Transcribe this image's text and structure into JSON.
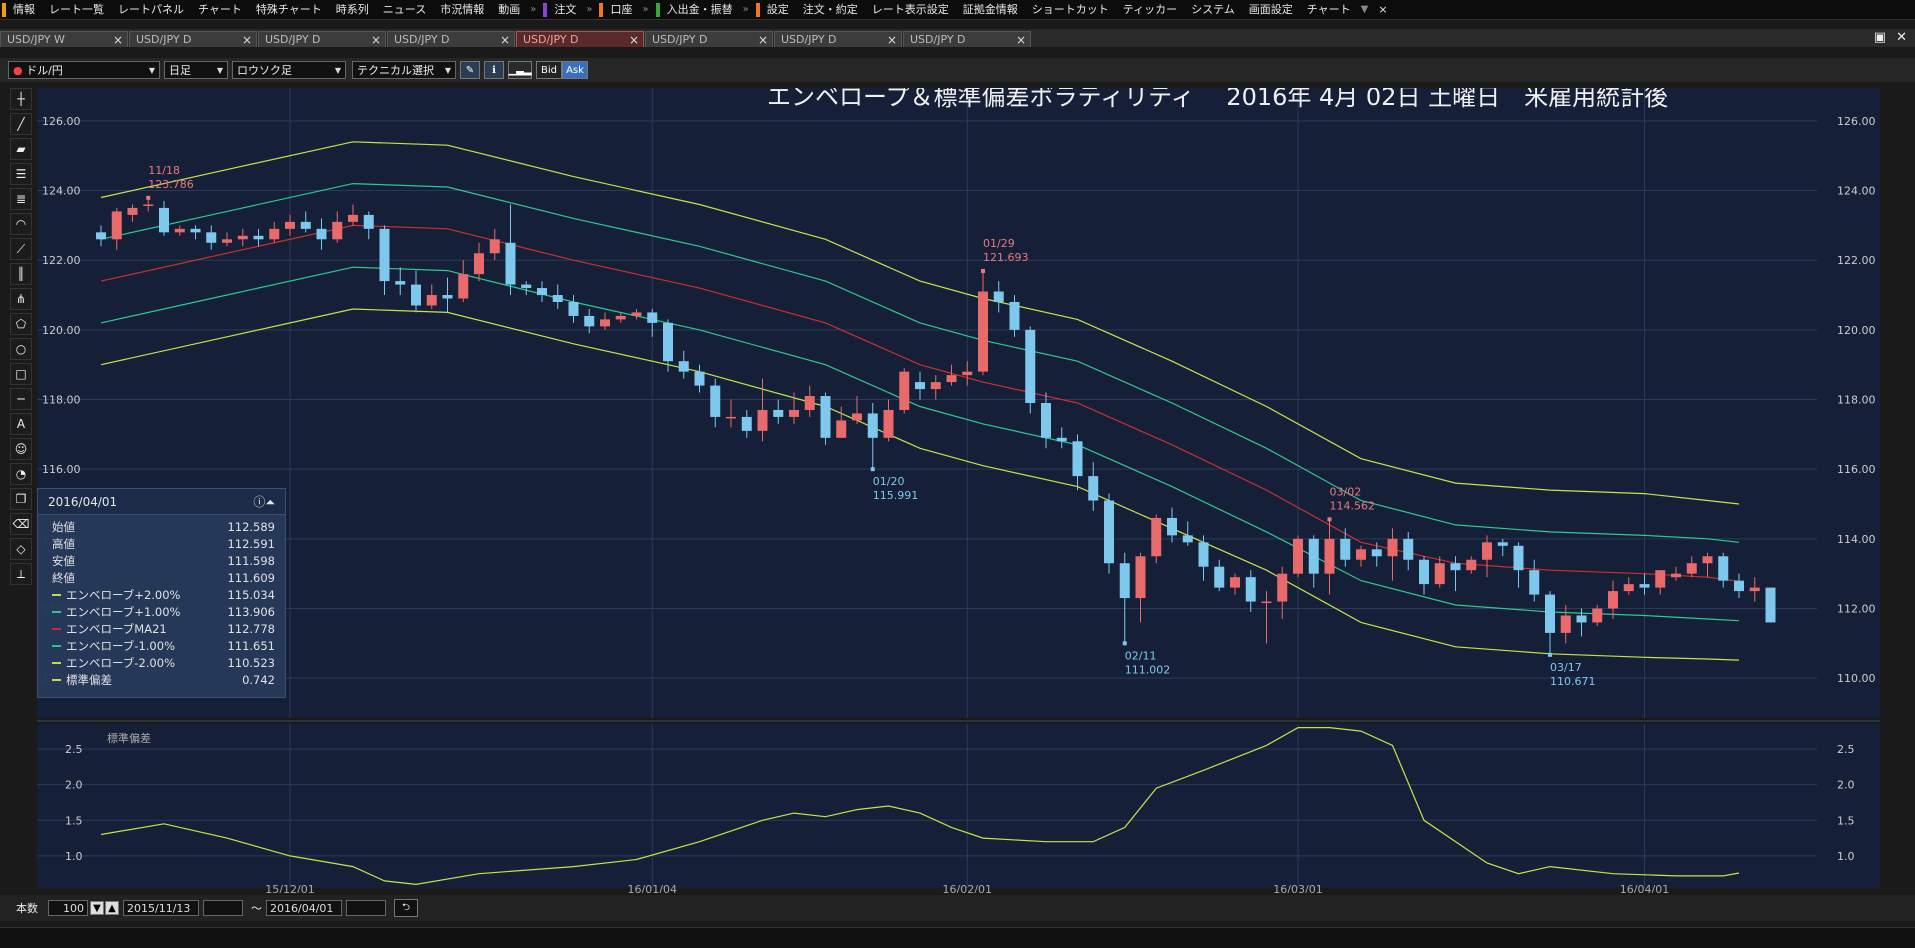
{
  "menubar": {
    "items": [
      "情報",
      "レート一覧",
      "レートパネル",
      "チャート",
      "特殊チャート",
      "時系列",
      "ニュース",
      "市況情報",
      "動画",
      "注文",
      "口座",
      "入出金・振替",
      "設定",
      "注文・約定",
      "レート表示設定",
      "証拠金情報",
      "ショートカット",
      "ティッカー",
      "システム",
      "画面設定",
      "チャート"
    ],
    "close": "×"
  },
  "tabs": [
    {
      "label": "USD/JPY W",
      "active": false
    },
    {
      "label": "USD/JPY D",
      "active": false
    },
    {
      "label": "USD/JPY D",
      "active": false
    },
    {
      "label": "USD/JPY D",
      "active": false
    },
    {
      "label": "USD/JPY D",
      "active": true
    },
    {
      "label": "USD/JPY D",
      "active": false
    },
    {
      "label": "USD/JPY D",
      "active": false
    },
    {
      "label": "USD/JPY D",
      "active": false
    }
  ],
  "toolbar": {
    "pair": "ドル/円",
    "period": "日足",
    "style": "ロウソク足",
    "technical": "テクニカル選択",
    "bid": "Bid",
    "ask": "Ask"
  },
  "tools": [
    "cross-icon",
    "line-icon",
    "eraser-icon",
    "hlines-icon",
    "multi-lines-icon",
    "arc-icon",
    "fan-icon",
    "vlines-icon",
    "pitchfork-icon",
    "pentagon-icon",
    "circle-icon",
    "rect-icon",
    "hline-icon",
    "text-icon",
    "smiley-icon",
    "paint-icon",
    "copy-icon",
    "delete-icon",
    "tag-icon",
    "ruler-icon"
  ],
  "bottombar": {
    "count_label": "本数",
    "count_value": "100",
    "from_date": "2015/11/13",
    "tilde": "〜",
    "to_date": "2016/04/01"
  },
  "info_panel": {
    "date": "2016/04/01",
    "rows": [
      {
        "label": "始値",
        "value": "112.589",
        "color": ""
      },
      {
        "label": "高値",
        "value": "112.591",
        "color": ""
      },
      {
        "label": "安値",
        "value": "111.598",
        "color": ""
      },
      {
        "label": "終値",
        "value": "111.609",
        "color": ""
      },
      {
        "label": "エンベローブ+2.00%",
        "value": "115.034",
        "color": "#c8e24a"
      },
      {
        "label": "エンベローブ+1.00%",
        "value": "113.906",
        "color": "#2ec990"
      },
      {
        "label": "エンベローブMA21",
        "value": "112.778",
        "color": "#c83030"
      },
      {
        "label": "エンベローブ-1.00%",
        "value": "111.651",
        "color": "#2ec990"
      },
      {
        "label": "エンベローブ-2.00%",
        "value": "110.523",
        "color": "#c8e24a"
      },
      {
        "label": "標準偏差",
        "value": "0.742",
        "color": "#c8e24a"
      }
    ]
  },
  "chart_data": {
    "type": "candlestick",
    "title": "エンベロープ＆標準偏差ボラティリティ　 2016年 4月 02日 土曜日　米雇用統計後",
    "ylim": [
      109.0,
      126.8
    ],
    "yticks": [
      "126.00",
      "124.00",
      "122.00",
      "120.00",
      "118.00",
      "116.00",
      "114.00",
      "112.00",
      "110.00"
    ],
    "xticks": [
      "15/12/01",
      "16/01/04",
      "16/02/01",
      "16/03/01",
      "16/04/01"
    ],
    "xtick_index": [
      12,
      35,
      55,
      76,
      98
    ],
    "candles": [
      [
        122.8,
        122.6,
        123.0,
        122.4
      ],
      [
        122.6,
        123.4,
        123.5,
        122.3
      ],
      [
        123.3,
        123.5,
        123.6,
        123.1
      ],
      [
        123.6,
        123.6,
        123.79,
        123.4
      ],
      [
        123.5,
        122.8,
        123.7,
        122.7
      ],
      [
        122.8,
        122.9,
        123.0,
        122.7
      ],
      [
        122.9,
        122.8,
        123.0,
        122.6
      ],
      [
        122.8,
        122.5,
        123.0,
        122.3
      ],
      [
        122.5,
        122.6,
        122.8,
        122.4
      ],
      [
        122.6,
        122.7,
        122.9,
        122.4
      ],
      [
        122.7,
        122.6,
        122.9,
        122.4
      ],
      [
        122.6,
        122.9,
        123.1,
        122.5
      ],
      [
        122.9,
        123.1,
        123.3,
        122.7
      ],
      [
        123.1,
        122.9,
        123.4,
        122.8
      ],
      [
        122.9,
        122.6,
        123.2,
        122.3
      ],
      [
        122.6,
        123.1,
        123.4,
        122.5
      ],
      [
        123.1,
        123.3,
        123.6,
        123.0
      ],
      [
        123.3,
        122.9,
        123.4,
        122.6
      ],
      [
        122.9,
        121.4,
        123.0,
        121.0
      ],
      [
        121.4,
        121.3,
        121.8,
        121.0
      ],
      [
        121.3,
        120.7,
        121.7,
        120.5
      ],
      [
        120.7,
        121.0,
        121.3,
        120.6
      ],
      [
        121.0,
        120.9,
        121.5,
        120.5
      ],
      [
        120.9,
        121.6,
        122.0,
        120.8
      ],
      [
        121.6,
        122.2,
        122.5,
        121.4
      ],
      [
        122.2,
        122.6,
        122.9,
        122.0
      ],
      [
        122.5,
        121.3,
        123.6,
        121.0
      ],
      [
        121.3,
        121.2,
        121.4,
        121.0
      ],
      [
        121.2,
        121.0,
        121.4,
        120.8
      ],
      [
        121.0,
        120.8,
        121.3,
        120.6
      ],
      [
        120.8,
        120.4,
        121.0,
        120.2
      ],
      [
        120.4,
        120.1,
        120.6,
        119.9
      ],
      [
        120.1,
        120.3,
        120.5,
        120.0
      ],
      [
        120.3,
        120.4,
        120.5,
        120.2
      ],
      [
        120.4,
        120.5,
        120.6,
        120.3
      ],
      [
        120.5,
        120.2,
        120.6,
        119.8
      ],
      [
        120.2,
        119.1,
        120.3,
        118.8
      ],
      [
        119.1,
        118.8,
        119.4,
        118.6
      ],
      [
        118.8,
        118.4,
        119.0,
        118.2
      ],
      [
        118.4,
        117.5,
        118.6,
        117.2
      ],
      [
        117.5,
        117.5,
        118.0,
        117.2
      ],
      [
        117.5,
        117.1,
        117.7,
        116.9
      ],
      [
        117.1,
        117.7,
        118.6,
        116.8
      ],
      [
        117.7,
        117.5,
        118.0,
        117.3
      ],
      [
        117.5,
        117.7,
        118.2,
        117.3
      ],
      [
        117.7,
        118.1,
        118.4,
        117.5
      ],
      [
        118.1,
        116.9,
        118.2,
        116.7
      ],
      [
        116.9,
        117.4,
        117.8,
        116.9
      ],
      [
        117.4,
        117.6,
        118.1,
        117.3
      ],
      [
        117.6,
        116.9,
        117.9,
        116.0
      ],
      [
        116.9,
        117.7,
        118.0,
        116.8
      ],
      [
        117.7,
        118.8,
        118.9,
        117.6
      ],
      [
        118.5,
        118.3,
        118.8,
        118.0
      ],
      [
        118.3,
        118.5,
        118.7,
        118.0
      ],
      [
        118.5,
        118.7,
        119.0,
        118.4
      ],
      [
        118.7,
        118.8,
        119.1,
        118.4
      ],
      [
        118.8,
        121.1,
        121.69,
        118.7
      ],
      [
        121.1,
        120.8,
        121.4,
        120.5
      ],
      [
        120.8,
        120.0,
        121.0,
        119.8
      ],
      [
        120.0,
        117.9,
        120.1,
        117.6
      ],
      [
        117.9,
        116.9,
        118.2,
        116.6
      ],
      [
        116.9,
        116.8,
        117.2,
        116.6
      ],
      [
        116.8,
        115.8,
        117.0,
        115.4
      ],
      [
        115.8,
        115.1,
        116.2,
        114.8
      ],
      [
        115.1,
        113.3,
        115.3,
        113.0
      ],
      [
        113.3,
        112.3,
        113.6,
        111.0
      ],
      [
        112.3,
        113.5,
        113.6,
        111.6
      ],
      [
        113.5,
        114.6,
        114.7,
        113.3
      ],
      [
        114.6,
        114.1,
        114.9,
        113.9
      ],
      [
        114.1,
        113.9,
        114.5,
        113.8
      ],
      [
        113.9,
        113.2,
        114.1,
        112.8
      ],
      [
        113.2,
        112.6,
        113.4,
        112.5
      ],
      [
        112.6,
        112.9,
        113.0,
        112.4
      ],
      [
        112.9,
        112.2,
        113.1,
        111.9
      ],
      [
        112.2,
        112.2,
        112.5,
        111.0
      ],
      [
        112.2,
        113.0,
        113.2,
        111.7
      ],
      [
        113.0,
        114.0,
        114.1,
        112.9
      ],
      [
        114.0,
        113.0,
        114.1,
        112.6
      ],
      [
        113.0,
        114.0,
        114.56,
        112.4
      ],
      [
        114.0,
        113.4,
        114.3,
        113.2
      ],
      [
        113.4,
        113.7,
        113.8,
        113.2
      ],
      [
        113.7,
        113.5,
        113.9,
        113.2
      ],
      [
        113.5,
        114.0,
        114.3,
        112.8
      ],
      [
        114.0,
        113.4,
        114.2,
        113.1
      ],
      [
        113.4,
        112.7,
        113.5,
        112.4
      ],
      [
        112.7,
        113.3,
        113.5,
        112.6
      ],
      [
        113.3,
        113.1,
        113.5,
        112.5
      ],
      [
        113.1,
        113.4,
        113.5,
        113.0
      ],
      [
        113.4,
        113.9,
        114.1,
        112.9
      ],
      [
        113.9,
        113.8,
        114.0,
        113.5
      ],
      [
        113.8,
        113.1,
        113.9,
        112.6
      ],
      [
        113.1,
        112.4,
        113.4,
        112.2
      ],
      [
        112.4,
        111.3,
        112.5,
        110.67
      ],
      [
        111.3,
        111.8,
        112.1,
        111.0
      ],
      [
        111.8,
        111.6,
        112.0,
        111.2
      ],
      [
        111.6,
        112.0,
        112.1,
        111.5
      ],
      [
        112.0,
        112.5,
        112.8,
        111.7
      ],
      [
        112.5,
        112.7,
        112.9,
        112.4
      ],
      [
        112.7,
        112.6,
        113.0,
        112.4
      ],
      [
        112.6,
        113.1,
        113.1,
        112.4
      ],
      [
        112.9,
        113.0,
        113.2,
        112.8
      ],
      [
        113.0,
        113.3,
        113.5,
        112.9
      ],
      [
        113.3,
        113.5,
        113.6,
        112.9
      ],
      [
        113.5,
        112.8,
        113.6,
        112.6
      ],
      [
        112.8,
        112.5,
        113.0,
        112.3
      ],
      [
        112.5,
        112.6,
        112.9,
        112.2
      ],
      [
        112.6,
        111.6,
        112.6,
        111.6
      ]
    ],
    "series": [
      {
        "name": "エンベローブ+2.00%",
        "color": "#c8e24a",
        "points": [
          [
            0,
            123.8
          ],
          [
            8,
            124.6
          ],
          [
            16,
            125.4
          ],
          [
            22,
            125.3
          ],
          [
            30,
            124.4
          ],
          [
            38,
            123.6
          ],
          [
            46,
            122.6
          ],
          [
            52,
            121.4
          ],
          [
            56,
            120.9
          ],
          [
            62,
            120.3
          ],
          [
            68,
            119.1
          ],
          [
            74,
            117.8
          ],
          [
            80,
            116.3
          ],
          [
            86,
            115.6
          ],
          [
            92,
            115.4
          ],
          [
            98,
            115.3
          ],
          [
            102,
            115.1
          ],
          [
            104,
            115.0
          ]
        ]
      },
      {
        "name": "エンベローブ+1.00%",
        "color": "#2ec990",
        "points": [
          [
            0,
            122.6
          ],
          [
            8,
            123.4
          ],
          [
            16,
            124.2
          ],
          [
            22,
            124.1
          ],
          [
            30,
            123.2
          ],
          [
            38,
            122.4
          ],
          [
            46,
            121.4
          ],
          [
            52,
            120.2
          ],
          [
            56,
            119.7
          ],
          [
            62,
            119.1
          ],
          [
            68,
            117.9
          ],
          [
            74,
            116.6
          ],
          [
            80,
            115.1
          ],
          [
            86,
            114.4
          ],
          [
            92,
            114.2
          ],
          [
            98,
            114.1
          ],
          [
            102,
            114.0
          ],
          [
            104,
            113.9
          ]
        ]
      },
      {
        "name": "エンベローブMA21",
        "color": "#c83030",
        "points": [
          [
            0,
            121.4
          ],
          [
            8,
            122.2
          ],
          [
            16,
            123.0
          ],
          [
            22,
            122.9
          ],
          [
            30,
            122.0
          ],
          [
            38,
            121.2
          ],
          [
            46,
            120.2
          ],
          [
            52,
            119.0
          ],
          [
            56,
            118.5
          ],
          [
            62,
            117.9
          ],
          [
            68,
            116.7
          ],
          [
            74,
            115.4
          ],
          [
            80,
            113.9
          ],
          [
            86,
            113.3
          ],
          [
            92,
            113.1
          ],
          [
            98,
            113.0
          ],
          [
            102,
            112.9
          ],
          [
            104,
            112.78
          ]
        ]
      },
      {
        "name": "エンベローブ-1.00%",
        "color": "#2ec990",
        "points": [
          [
            0,
            120.2
          ],
          [
            8,
            121.0
          ],
          [
            16,
            121.8
          ],
          [
            22,
            121.7
          ],
          [
            30,
            120.8
          ],
          [
            38,
            120.0
          ],
          [
            46,
            119.0
          ],
          [
            52,
            117.8
          ],
          [
            56,
            117.3
          ],
          [
            62,
            116.7
          ],
          [
            68,
            115.5
          ],
          [
            74,
            114.2
          ],
          [
            80,
            112.8
          ],
          [
            86,
            112.1
          ],
          [
            92,
            111.9
          ],
          [
            98,
            111.8
          ],
          [
            102,
            111.7
          ],
          [
            104,
            111.65
          ]
        ]
      },
      {
        "name": "エンベローブ-2.00%",
        "color": "#c8e24a",
        "points": [
          [
            0,
            119.0
          ],
          [
            8,
            119.8
          ],
          [
            16,
            120.6
          ],
          [
            22,
            120.5
          ],
          [
            30,
            119.6
          ],
          [
            38,
            118.8
          ],
          [
            46,
            117.8
          ],
          [
            52,
            116.6
          ],
          [
            56,
            116.1
          ],
          [
            62,
            115.5
          ],
          [
            68,
            114.3
          ],
          [
            74,
            113.1
          ],
          [
            80,
            111.6
          ],
          [
            86,
            110.9
          ],
          [
            92,
            110.7
          ],
          [
            98,
            110.6
          ],
          [
            102,
            110.55
          ],
          [
            104,
            110.52
          ]
        ]
      }
    ],
    "annotations": [
      {
        "index": 3,
        "date": "11/18",
        "value": "123.786",
        "kind": "high"
      },
      {
        "index": 56,
        "date": "01/29",
        "value": "121.693",
        "kind": "high"
      },
      {
        "index": 49,
        "date": "01/20",
        "value": "115.991",
        "kind": "low"
      },
      {
        "index": 65,
        "date": "02/11",
        "value": "111.002",
        "kind": "low"
      },
      {
        "index": 78,
        "date": "03/02",
        "value": "114.562",
        "kind": "high"
      },
      {
        "index": 92,
        "date": "03/17",
        "value": "110.671",
        "kind": "low"
      }
    ],
    "sub_chart": {
      "label": "標準偏差",
      "ylim": [
        0.55,
        2.85
      ],
      "yticks": [
        "2.5",
        "2.0",
        "1.5",
        "1.0"
      ],
      "color": "#c8e24a",
      "points": [
        [
          0,
          1.3
        ],
        [
          4,
          1.45
        ],
        [
          8,
          1.25
        ],
        [
          12,
          1.0
        ],
        [
          16,
          0.85
        ],
        [
          18,
          0.65
        ],
        [
          20,
          0.6
        ],
        [
          24,
          0.75
        ],
        [
          30,
          0.85
        ],
        [
          34,
          0.95
        ],
        [
          38,
          1.2
        ],
        [
          42,
          1.5
        ],
        [
          44,
          1.6
        ],
        [
          46,
          1.55
        ],
        [
          48,
          1.65
        ],
        [
          50,
          1.7
        ],
        [
          52,
          1.6
        ],
        [
          54,
          1.4
        ],
        [
          56,
          1.25
        ],
        [
          60,
          1.2
        ],
        [
          63,
          1.2
        ],
        [
          65,
          1.4
        ],
        [
          67,
          1.95
        ],
        [
          70,
          2.2
        ],
        [
          74,
          2.55
        ],
        [
          76,
          2.8
        ],
        [
          78,
          2.8
        ],
        [
          80,
          2.75
        ],
        [
          82,
          2.55
        ],
        [
          84,
          1.5
        ],
        [
          88,
          0.9
        ],
        [
          90,
          0.75
        ],
        [
          92,
          0.85
        ],
        [
          96,
          0.75
        ],
        [
          100,
          0.72
        ],
        [
          103,
          0.72
        ],
        [
          104,
          0.76
        ]
      ]
    }
  }
}
